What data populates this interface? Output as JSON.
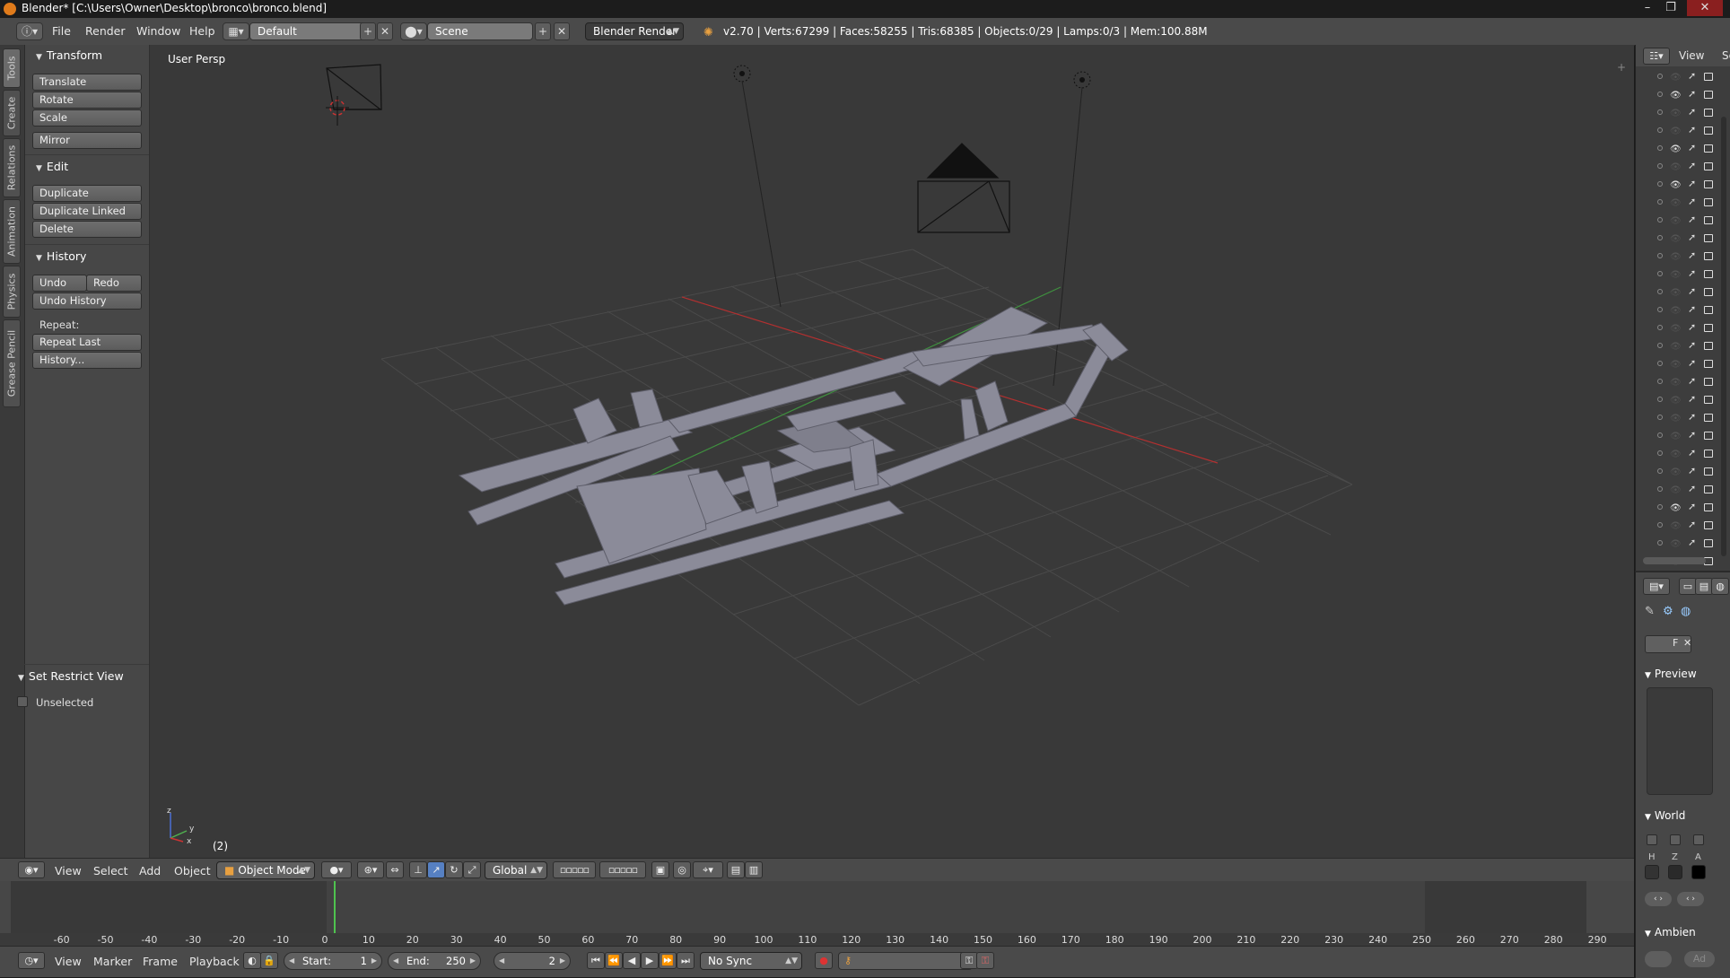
{
  "window": {
    "title": "Blender* [C:\\Users\\Owner\\Desktop\\bronco\\bronco.blend]",
    "controls": [
      "–",
      "❐",
      "✕"
    ]
  },
  "info_header": {
    "menus": [
      "File",
      "Render",
      "Window",
      "Help"
    ],
    "layout": "Default",
    "scene": "Scene",
    "render_engine": "Blender Render",
    "stats": "v2.70 | Verts:67299 | Faces:58255 | Tris:68385 | Objects:0/29 | Lamps:0/3 | Mem:100.88M"
  },
  "vertical_tabs": [
    "Tools",
    "Create",
    "Relations",
    "Animation",
    "Physics",
    "Grease Pencil"
  ],
  "tool_shelf": {
    "transform": {
      "title": "Transform",
      "buttons": [
        "Translate",
        "Rotate",
        "Scale",
        "Mirror"
      ]
    },
    "edit": {
      "title": "Edit",
      "buttons": [
        "Duplicate",
        "Duplicate Linked",
        "Delete"
      ]
    },
    "history": {
      "title": "History",
      "undo": "Undo",
      "redo": "Redo",
      "undo_history": "Undo History",
      "repeat_label": "Repeat:",
      "repeat_last": "Repeat Last",
      "history_dots": "History..."
    },
    "restrict": {
      "title": "Set Restrict View",
      "unselected": "Unselected"
    }
  },
  "viewport": {
    "label": "User Persp",
    "frame_indicator": "(2)",
    "axis_labels": {
      "x": "x",
      "y": "y",
      "z": "z"
    }
  },
  "viewport_header": {
    "menus": [
      "View",
      "Select",
      "Add",
      "Object"
    ],
    "mode": "Object Mode",
    "orientation": "Global"
  },
  "timeline": {
    "ticks": [
      "-60",
      "-50",
      "-40",
      "-30",
      "-20",
      "-10",
      "0",
      "10",
      "20",
      "30",
      "40",
      "50",
      "60",
      "70",
      "80",
      "90",
      "100",
      "110",
      "120",
      "130",
      "140",
      "150",
      "160",
      "170",
      "180",
      "190",
      "200",
      "210",
      "220",
      "230",
      "240",
      "250",
      "260",
      "270",
      "280",
      "290"
    ],
    "current_frame": 2,
    "menus": [
      "View",
      "Marker",
      "Frame",
      "Playback"
    ],
    "start_label": "Start:",
    "start_value": "1",
    "end_label": "End:",
    "end_value": "250",
    "frame_value": "2",
    "sync": "No Sync"
  },
  "outliner": {
    "view_label": "View",
    "search_label": "Se"
  },
  "properties": {
    "f_label": "F",
    "preview": "Preview",
    "world": "World",
    "hza": [
      "H",
      "Z",
      "A"
    ],
    "ambient": "Ambien",
    "add_label": "Ad"
  },
  "colors": {
    "viewport_bg": "#393939",
    "mesh": "#8b8b99",
    "grid": "#4a4a4a",
    "x_axis": "#b23030",
    "y_axis": "#3f8f3f",
    "playhead": "#4fc34f",
    "accent": "#5680c2"
  }
}
